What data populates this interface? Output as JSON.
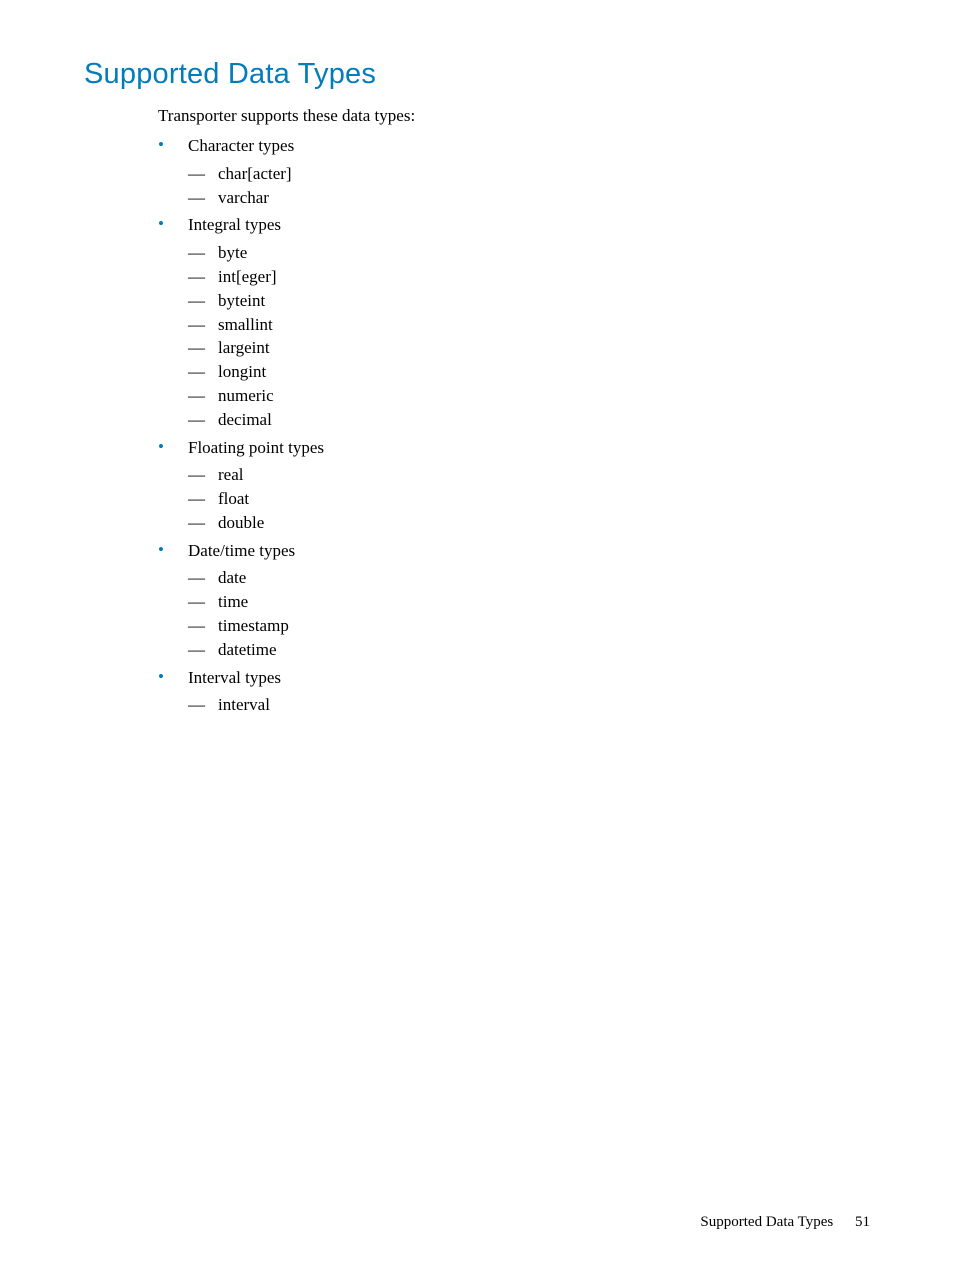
{
  "heading": "Supported Data Types",
  "intro": "Transporter supports these data types:",
  "groups": [
    {
      "title": "Character types",
      "items": [
        "char[acter]",
        "varchar"
      ]
    },
    {
      "title": "Integral types",
      "items": [
        "byte",
        "int[eger]",
        "byteint",
        "smallint",
        "largeint",
        "longint",
        "numeric",
        "decimal"
      ]
    },
    {
      "title": "Floating point types",
      "items": [
        "real",
        "float",
        "double"
      ]
    },
    {
      "title": "Date/time types",
      "items": [
        "date",
        "time",
        "timestamp",
        "datetime"
      ]
    },
    {
      "title": "Interval types",
      "items": [
        "interval"
      ]
    }
  ],
  "footer": {
    "label": "Supported Data Types",
    "page": "51"
  }
}
